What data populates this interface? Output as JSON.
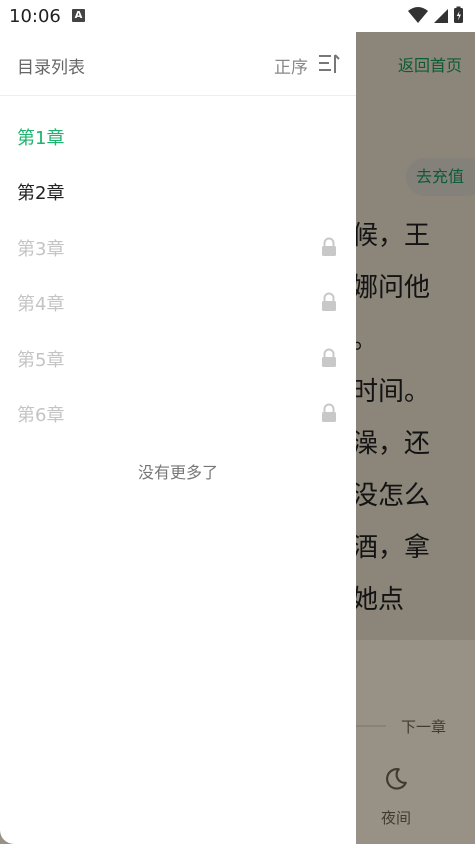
{
  "status_bar": {
    "time": "10:06",
    "notification_icon": "A"
  },
  "drawer": {
    "title": "目录列表",
    "sort_label": "正序",
    "chapters": [
      {
        "label": "第1章",
        "state": "current",
        "locked": false
      },
      {
        "label": "第2章",
        "state": "available",
        "locked": false
      },
      {
        "label": "第3章",
        "state": "locked",
        "locked": true
      },
      {
        "label": "第4章",
        "state": "locked",
        "locked": true
      },
      {
        "label": "第5章",
        "state": "locked",
        "locked": true
      },
      {
        "label": "第6章",
        "state": "locked",
        "locked": true
      }
    ],
    "no_more_text": "没有更多了"
  },
  "reader": {
    "back_home_label": "返回首页",
    "recharge_label": "去充值",
    "text_lines": [
      "候，王",
      "娜问他",
      "。",
      "时间。",
      "澡，还",
      "没怎么",
      "酒，拿",
      "她点"
    ],
    "next_chapter_label": "下一章",
    "night_mode_label": "夜间"
  },
  "colors": {
    "accent": "#1aa05f",
    "current_chapter": "#1db36e",
    "locked_text": "#c4c4c4",
    "normal_text": "#222222"
  }
}
